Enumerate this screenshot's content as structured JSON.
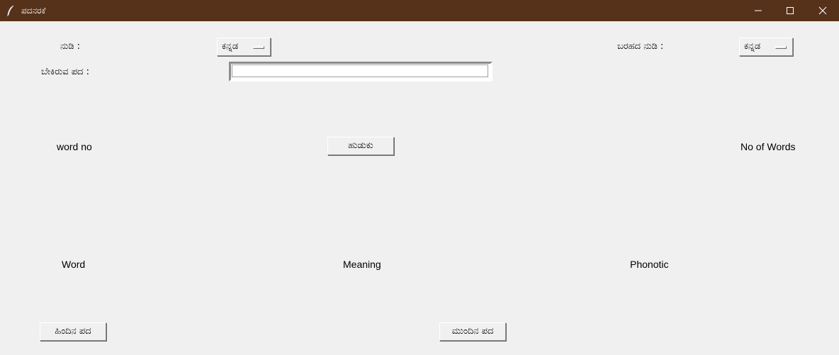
{
  "window": {
    "title": "ಪದನರಕೆ",
    "icon": "feather-icon",
    "controls": {
      "minimize": "minimize-icon",
      "maximize": "maximize-icon",
      "close": "close-icon"
    }
  },
  "form": {
    "language_label": "ನುಡಿ :",
    "language_value": "ಕನ್ನಡ",
    "script_label": "ಬರಹದ ನುಡಿ :",
    "script_value": "ಕನ್ನಡ",
    "search_label": "ಬೇಕಿರುವ ಪದ :",
    "search_value": "",
    "search_placeholder": ""
  },
  "search_row": {
    "word_no_label": "word no",
    "search_button": "ಹುಡುಕು",
    "no_of_words_label": "No of Words"
  },
  "result_row": {
    "word_label": "Word",
    "meaning_label": "Meaning",
    "phonetic_label": "Phonotic"
  },
  "navigation": {
    "prev_button": "ಹಿಂದಿನ ಪದ",
    "next_button": "ಮುಂದಿನ ಪದ"
  },
  "colors": {
    "titlebar": "#57321b",
    "window_bg": "#f0f0f0"
  }
}
